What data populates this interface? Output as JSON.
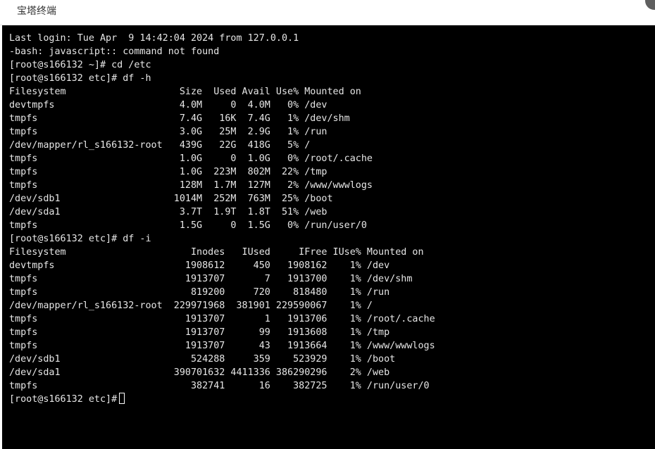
{
  "window": {
    "title": "宝塔终端"
  },
  "terminal": {
    "lines": [
      "Last login: Tue Apr  9 14:42:04 2024 from 127.0.0.1",
      "-bash: javascript:: command not found",
      "[root@s166132 ~]# cd /etc",
      "[root@s166132 etc]# df -h",
      "Filesystem                    Size  Used Avail Use% Mounted on",
      "devtmpfs                      4.0M     0  4.0M   0% /dev",
      "tmpfs                         7.4G   16K  7.4G   1% /dev/shm",
      "tmpfs                         3.0G   25M  2.9G   1% /run",
      "/dev/mapper/rl_s166132-root   439G   22G  418G   5% /",
      "tmpfs                         1.0G     0  1.0G   0% /root/.cache",
      "tmpfs                         1.0G  223M  802M  22% /tmp",
      "tmpfs                         128M  1.7M  127M   2% /www/wwwlogs",
      "/dev/sdb1                    1014M  252M  763M  25% /boot",
      "/dev/sda1                     3.7T  1.9T  1.8T  51% /web",
      "tmpfs                         1.5G     0  1.5G   0% /run/user/0",
      "[root@s166132 etc]# df -i",
      "Filesystem                      Inodes   IUsed     IFree IUse% Mounted on",
      "devtmpfs                       1908612     450   1908162    1% /dev",
      "tmpfs                          1913707       7   1913700    1% /dev/shm",
      "tmpfs                           819200     720    818480    1% /run",
      "/dev/mapper/rl_s166132-root  229971968  381901 229590067    1% /",
      "tmpfs                          1913707       1   1913706    1% /root/.cache",
      "tmpfs                          1913707      99   1913608    1% /tmp",
      "tmpfs                          1913707      43   1913664    1% /www/wwwlogs",
      "/dev/sdb1                       524288     359    523929    1% /boot",
      "/dev/sda1                    390701632 4411336 386290296    2% /web",
      "tmpfs                           382741      16    382725    1% /run/user/0"
    ],
    "prompt": "[root@s166132 etc]#"
  }
}
